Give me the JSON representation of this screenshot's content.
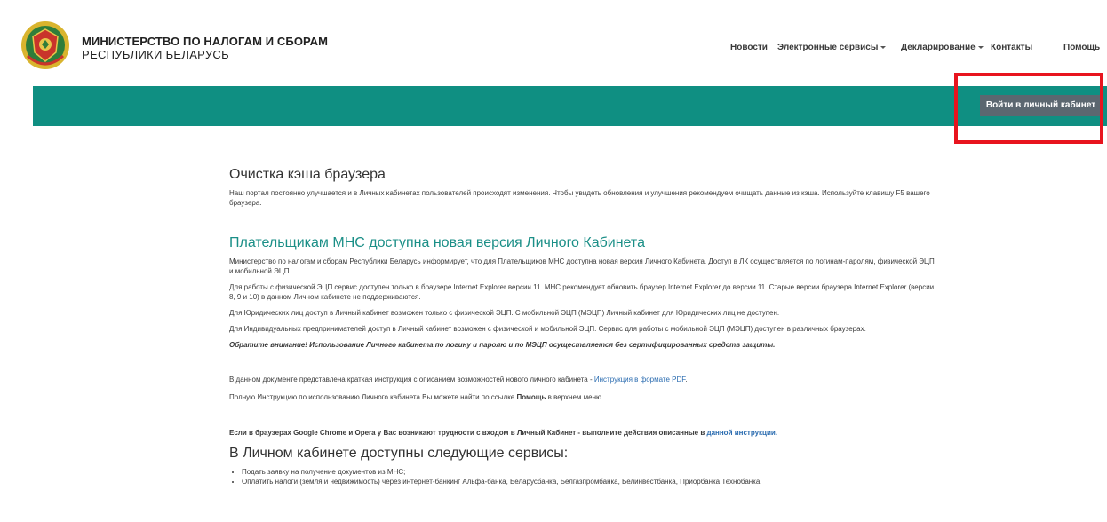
{
  "header": {
    "org_line1": "МИНИСТЕРСТВО ПО НАЛОГАМ И СБОРАМ",
    "org_line2": "РЕСПУБЛИКИ БЕЛАРУСЬ",
    "nav": {
      "news": "Новости",
      "eservices": "Электронные сервисы",
      "declaring": "Декларирование",
      "contacts": "Контакты",
      "help": "Помощь"
    }
  },
  "login_button": "Войти в личный кабинет",
  "content": {
    "cache_title": "Очистка кэша браузера",
    "cache_text": "Наш портал постоянно улучшается и в Личных кабинетах пользователей происходят изменения. Чтобы увидеть обновления и улучшения рекомендуем очищать данные из кэша. Используйте клавишу F5 вашего браузера.",
    "new_version_title": "Плательщикам МНС доступна новая версия Личного Кабинета",
    "p1": "Министерство по налогам и сборам Республики Беларусь информирует, что для Плательщиков МНС доступна новая версия Личного Кабинета. Доступ в ЛК осуществляется по логинам-паролям, физической ЭЦП и мобильной ЭЦП.",
    "p2": "Для работы с физической ЭЦП сервис доступен только в браузере Internet Explorer версии 11. МНС рекомендует обновить браузер Internet Explorer до версии 11. Старые версии браузера Internet Explorer (версии 8, 9 и 10) в данном Личном кабинете не поддерживаются.",
    "p3": "Для Юридических лиц доступ в Личный кабинет возможен только с физической ЭЦП. С мобильной ЭЦП (МЭЦП) Личный кабинет для Юридических лиц не доступен.",
    "p4": "Для Индивидуальных предпринимателей доступ в Личный кабинет возможен с физической и мобильной ЭЦП. Сервис для работы с мобильной ЭЦП (МЭЦП) доступен в различных браузерах.",
    "attention": "Обратите внимание! Использование Личного кабинета по логину и паролю и по МЭЦП осуществляется без сертифицированных средств защиты.",
    "doc_text": "В данном документе представлена краткая инструкция с описанием возможностей нового личного кабинета - ",
    "doc_link": "Инструкция в формате PDF",
    "doc_end": ".",
    "full_text_start": "Полную Инструкцию по использованию Личного кабинета Вы можете найти по ссылке ",
    "full_text_bold": "Помощь",
    "full_text_end": " в верхнем меню.",
    "chrome_text": "Если в браузерах Google Chrome и Opera у Вас возникают трудности с входом в Личный Кабинет - выполните действия описанные в ",
    "chrome_link": "данной инструкции.",
    "services_title": "В Личном кабинете доступны следующие сервисы:",
    "services": [
      "Подать заявку на получение документов из МНС;",
      "Оплатить налоги (земля и недвижимость) через интернет-банкинг Альфа-банка, Беларусбанка, Белгазпромбанка, Белинвестбанка, Приорбанка Технобанка,"
    ]
  }
}
